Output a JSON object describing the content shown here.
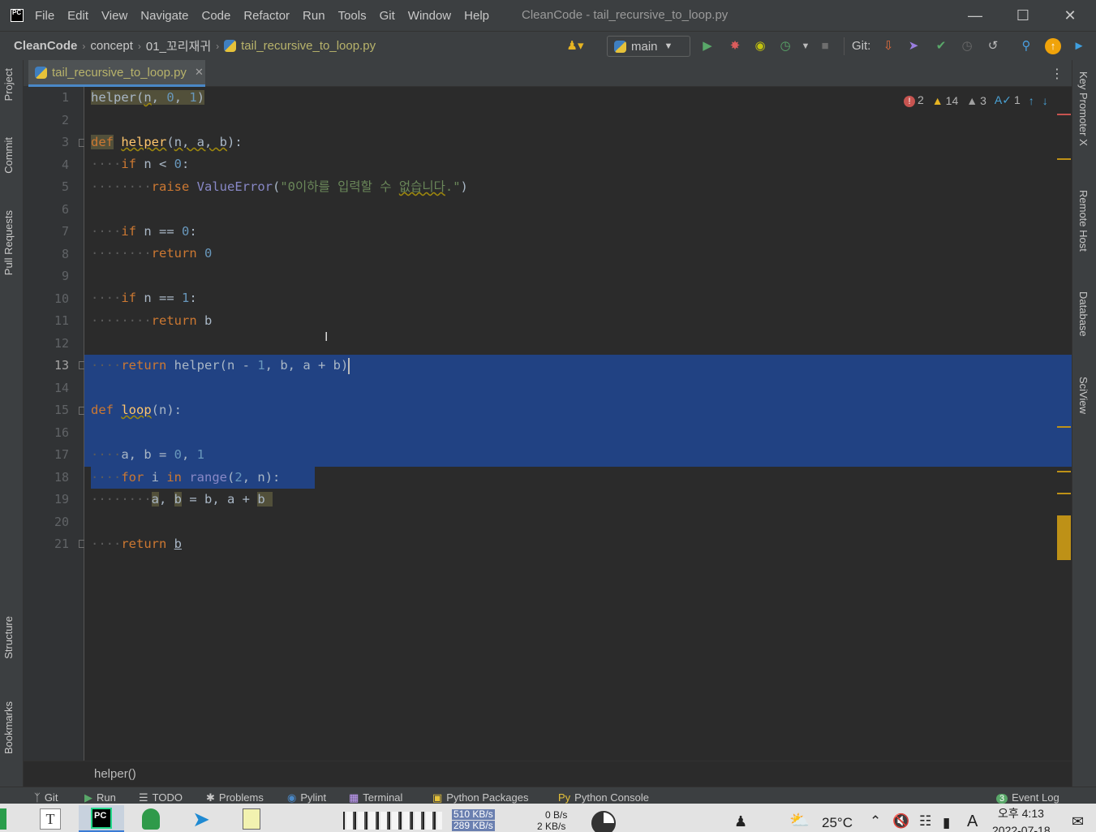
{
  "app": {
    "logo": "PC",
    "window_title": "CleanCode - tail_recursive_to_loop.py"
  },
  "menu": [
    "File",
    "Edit",
    "View",
    "Navigate",
    "Code",
    "Refactor",
    "Run",
    "Tools",
    "Git",
    "Window",
    "Help"
  ],
  "breadcrumbs": {
    "project": "CleanCode",
    "folder1": "concept",
    "folder2": "01_꼬리재귀",
    "file": "tail_recursive_to_loop.py"
  },
  "toolbar": {
    "branch": "main",
    "git_label": "Git:"
  },
  "tab": {
    "label": "tail_recursive_to_loop.py",
    "close": "✕"
  },
  "left_tools": [
    "Project",
    "Commit",
    "Pull Requests",
    "Structure",
    "Bookmarks"
  ],
  "right_tools": [
    "Key Promoter X",
    "Remote Host",
    "Database",
    "SciView"
  ],
  "inspections": {
    "errors": "2",
    "warnings": "14",
    "weak_warnings": "3",
    "typos": "1"
  },
  "editor": {
    "line_numbers": [
      "1",
      "2",
      "3",
      "4",
      "5",
      "6",
      "7",
      "8",
      "9",
      "10",
      "11",
      "12",
      "13",
      "14",
      "15",
      "16",
      "17",
      "18",
      "19",
      "20",
      "21"
    ],
    "current_line": "13",
    "footer_crumb": "helper()"
  },
  "bottom_tools": {
    "git": "Git",
    "run": "Run",
    "todo": "TODO",
    "problems": "Problems",
    "pylint": "Pylint",
    "terminal": "Terminal",
    "python_packages": "Python Packages",
    "python_console": "Python Console",
    "event_log_count": "3",
    "event_log": "Event Log"
  },
  "taskbar": {
    "net_up": "510 KB/s",
    "net_down": "289 KB/s",
    "disk_read": "0 B/s",
    "disk_write": "2 KB/s",
    "temperature": "25°C",
    "ime": "A",
    "time": "오후 4:13",
    "date": "2022-07-18"
  },
  "colors": {
    "selection": "#214283",
    "keyword": "#cc7832",
    "function": "#ffc66d",
    "number": "#6897bb",
    "string": "#6a8759",
    "accent_tab": "#4a88c7"
  }
}
